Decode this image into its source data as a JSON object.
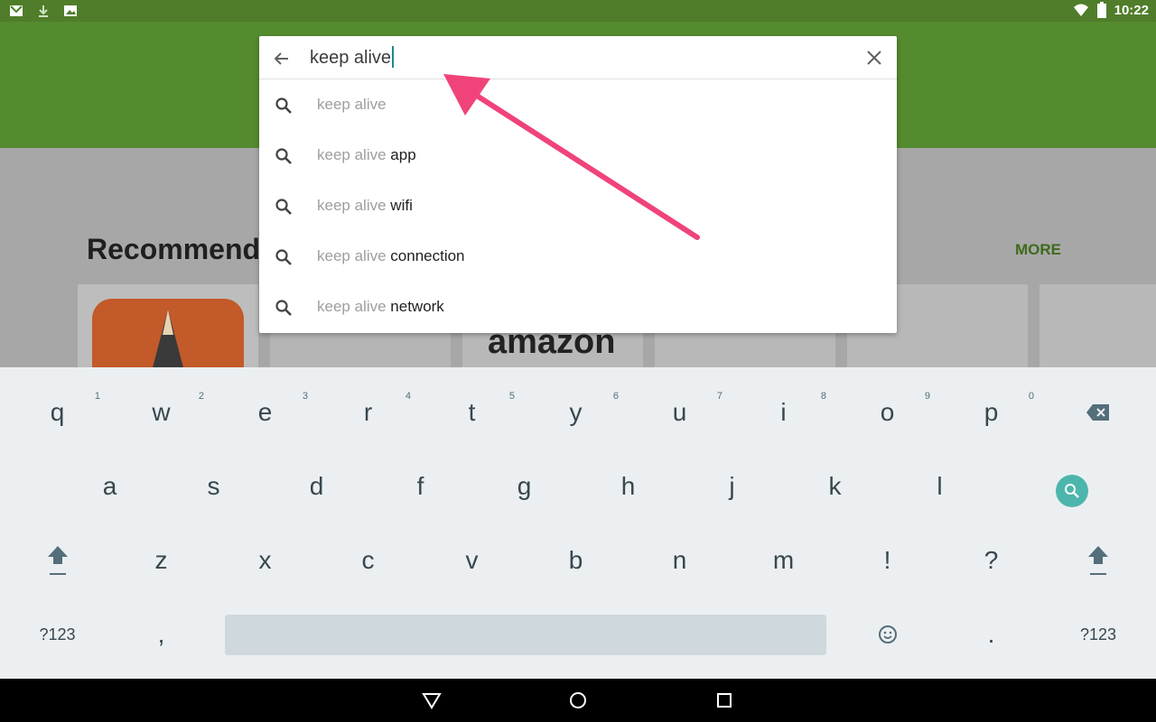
{
  "status_bar": {
    "time": "10:22",
    "icons": [
      "gmail-icon",
      "download-icon",
      "image-icon",
      "wifi-icon",
      "battery-icon"
    ]
  },
  "content": {
    "section_title": "Recommend",
    "more_label": "MORE",
    "card_labels": [
      "amazon"
    ]
  },
  "search": {
    "query": "keep alive",
    "suggestions": [
      {
        "prefix": "keep alive",
        "suffix": ""
      },
      {
        "prefix": "keep alive",
        "suffix": " app"
      },
      {
        "prefix": "keep alive",
        "suffix": " wifi"
      },
      {
        "prefix": "keep alive",
        "suffix": " connection"
      },
      {
        "prefix": "keep alive",
        "suffix": " network"
      }
    ]
  },
  "keyboard": {
    "row1": [
      "q",
      "w",
      "e",
      "r",
      "t",
      "y",
      "u",
      "i",
      "o",
      "p"
    ],
    "row1_hints": [
      "1",
      "2",
      "3",
      "4",
      "5",
      "6",
      "7",
      "8",
      "9",
      "0"
    ],
    "row2": [
      "a",
      "s",
      "d",
      "f",
      "g",
      "h",
      "j",
      "k",
      "l"
    ],
    "row3": [
      "z",
      "x",
      "c",
      "v",
      "b",
      "n",
      "m",
      "!",
      "?"
    ],
    "symbols_label": "?123",
    "comma": ",",
    "period": "."
  },
  "colors": {
    "status_bar": "#4f7d2a",
    "app_bar": "#558b2f",
    "accent": "#4db6ac",
    "annotation_arrow": "#f0437a"
  }
}
